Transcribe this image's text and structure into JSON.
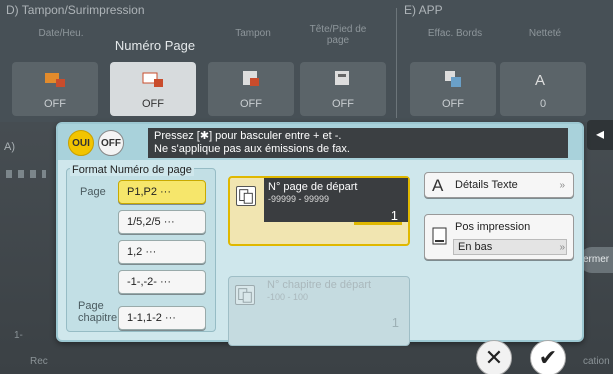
{
  "background": {
    "group_left_title": "D)  Tampon/Surimpression",
    "group_right_title": "E)  APP",
    "tabs": [
      {
        "label": "Date/Heu.",
        "value": "OFF"
      },
      {
        "label": "Numéro Page",
        "value": "OFF"
      },
      {
        "label": "Tampon",
        "value": "OFF"
      },
      {
        "label": "Tête/Pied de page",
        "value": "OFF"
      },
      {
        "label": "Effac. Bords",
        "value": "OFF"
      },
      {
        "label": "Netteté",
        "value": "0"
      }
    ],
    "side_label": "A)",
    "side_text": "1-",
    "fermer_label": "ermer",
    "bottom_labels": [
      "Rec",
      "cation"
    ],
    "right_arrow": "◂"
  },
  "popup": {
    "toggle_on": "OUI",
    "toggle_off": "OFF",
    "message_line1": "Pressez [✱] pour basculer entre + et -.",
    "message_line2": "Ne s'applique pas aux émissions de fax.",
    "format_title": "Format Numéro de page",
    "label_page": "Page",
    "label_chapter_1": "Page",
    "label_chapter_2": "chapitre",
    "options": [
      "P1,P2 ···",
      "1/5,2/5 ···",
      "1,2 ···",
      "-1-,-2- ···",
      "1-1,1-2 ···"
    ],
    "selected_option_index": 0,
    "start_page": {
      "title": "N° page de départ",
      "range": "-99999 - 99999",
      "value": "1"
    },
    "start_chapter": {
      "title": "N° chapitre de départ",
      "range": "-100 - 100",
      "value": "1"
    },
    "text_details_label": "Détails Texte",
    "position_label": "Pos impression",
    "position_value": "En bas",
    "chevron": "»",
    "cancel_glyph": "✕",
    "ok_glyph": "✔"
  },
  "colors": {
    "accent_yellow": "#f2c400",
    "popup_bg": "#cfe7ec"
  }
}
